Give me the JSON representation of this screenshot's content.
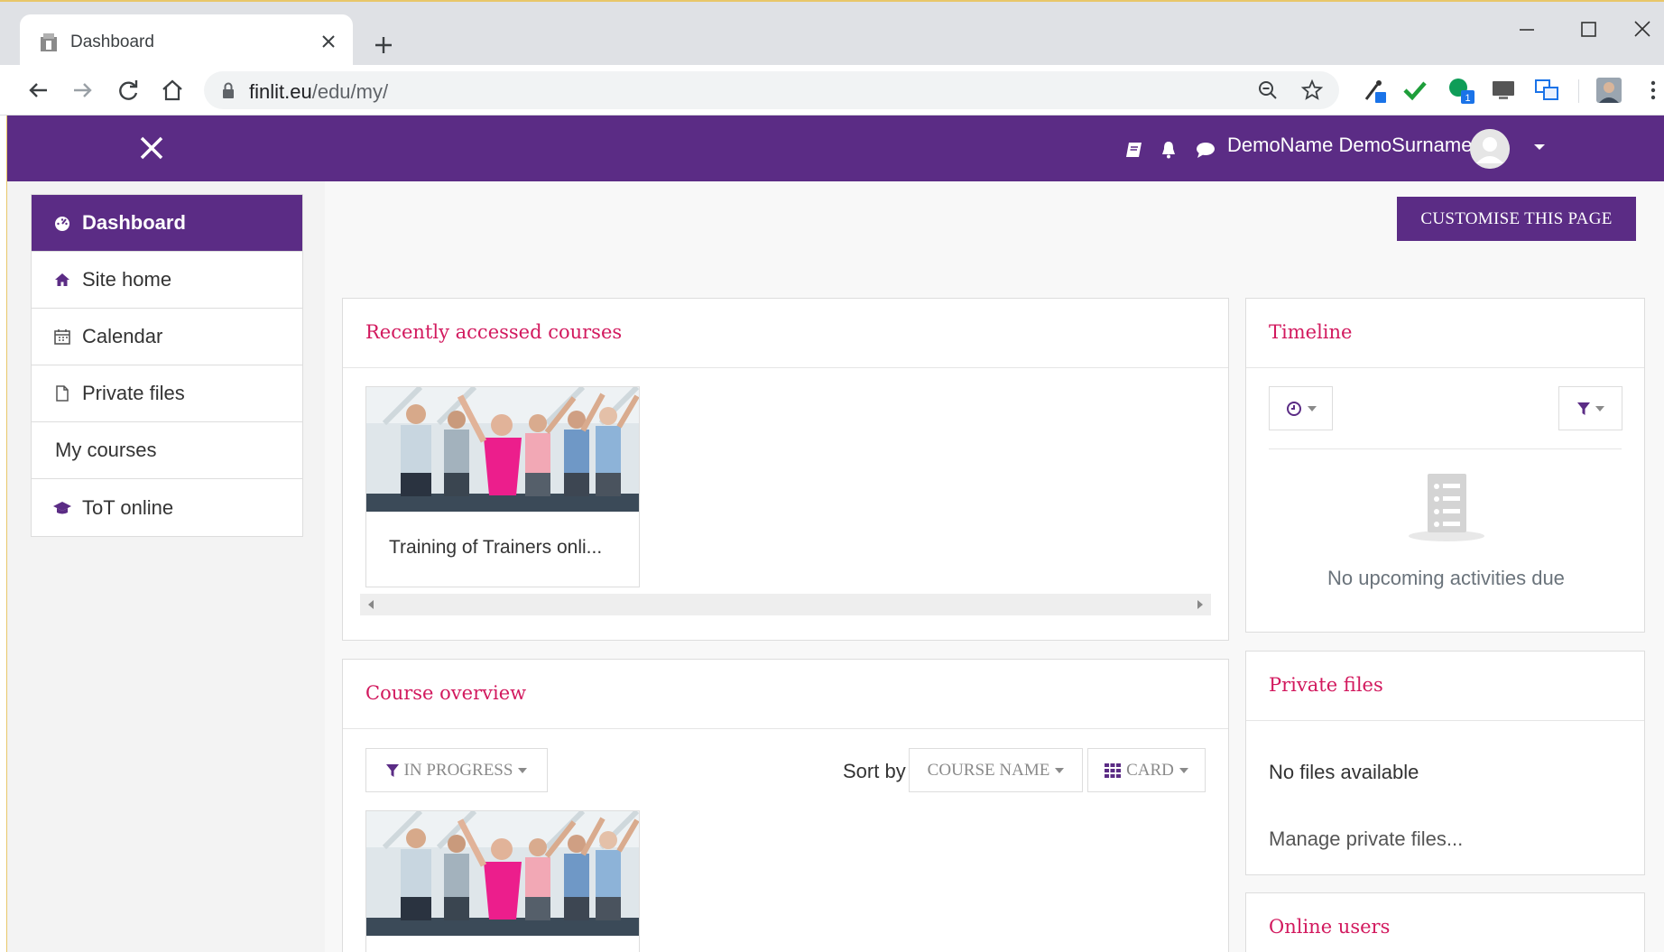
{
  "browser": {
    "tab_title": "Dashboard",
    "url_host": "finlit.eu",
    "url_path": "/edu/my/",
    "extension_badge": "1"
  },
  "navbar": {
    "user_name": "DemoName DemoSurname"
  },
  "nav_drawer": {
    "items": [
      {
        "label": "Dashboard",
        "icon": "dashboard-icon",
        "active": true
      },
      {
        "label": "Site home",
        "icon": "home-icon"
      },
      {
        "label": "Calendar",
        "icon": "calendar-icon"
      },
      {
        "label": "Private files",
        "icon": "file-icon"
      },
      {
        "label": "My courses",
        "icon": ""
      },
      {
        "label": "ToT online",
        "icon": "graduation-cap-icon"
      }
    ]
  },
  "page": {
    "customise_button": "CUSTOMISE THIS PAGE"
  },
  "recent_courses": {
    "title": "Recently accessed courses",
    "courses": [
      {
        "name": "Training of Trainers onli..."
      }
    ]
  },
  "course_overview": {
    "title": "Course overview",
    "filter_label": "IN PROGRESS",
    "sort_by_label": "Sort by",
    "sort_value": "COURSE NAME",
    "view_label": "CARD"
  },
  "timeline": {
    "title": "Timeline",
    "empty_message": "No upcoming activities due"
  },
  "private_files": {
    "title": "Private files",
    "empty_message": "No files available",
    "manage_link": "Manage private files..."
  },
  "online_users": {
    "title": "Online users"
  },
  "colors": {
    "brand_purple": "#5b2c85",
    "heading_pink": "#d2195e"
  }
}
